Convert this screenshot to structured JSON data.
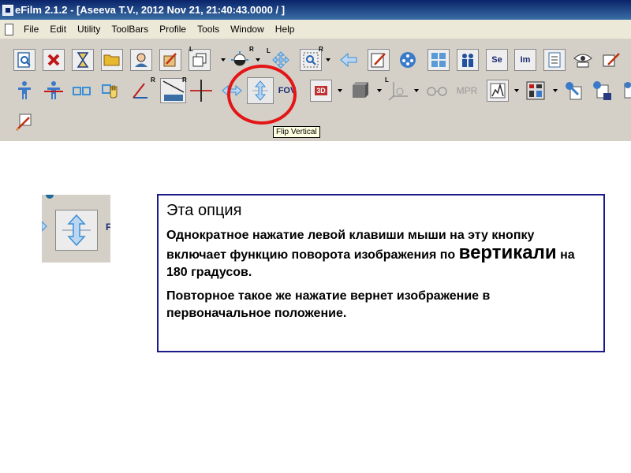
{
  "window": {
    "title": "eFilm 2.1.2 - [Aseeva T.V., 2012 Nov 21, 21:40:43.0000  /  ]"
  },
  "menu": [
    "File",
    "Edit",
    "Utility",
    "ToolBars",
    "Profile",
    "Tools",
    "Window",
    "Help"
  ],
  "toolbar": {
    "corner_labels": {
      "l": "L",
      "r": "R"
    },
    "series_label": "Se",
    "image_label": "Im",
    "mpr_label": "MPR",
    "fov_label": "FOV",
    "threed_label": "3D"
  },
  "tooltip": {
    "text": "Flip Vertical"
  },
  "zoom_preview": {
    "right_glyph": "F"
  },
  "info": {
    "title": "Эта опция",
    "p1_before": "Однократное нажатие левой клавиши мыши на эту кнопку  включает функцию поворота изображения по ",
    "p1_emph": "вертикали",
    "p1_after": " на 180 градусов.",
    "p2": "Повторное такое же нажатие вернет изображение в первоначальное положение."
  },
  "colors": {
    "titlebar": "#0a246a",
    "toolbar_bg": "#d4d0c8",
    "highlight_circle": "#e31515",
    "info_border": "#1a1a8c",
    "icon_blue": "#3a8fd6"
  }
}
